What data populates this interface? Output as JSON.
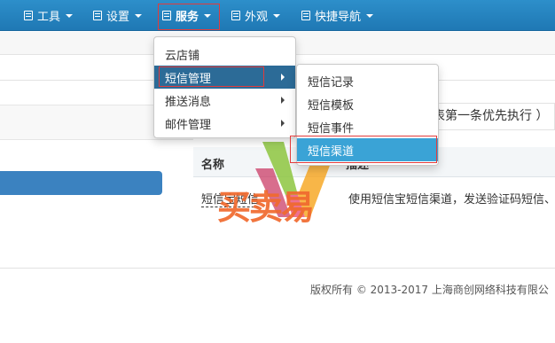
{
  "colors": {
    "navbar": "#2583c0",
    "highlight": "#2c6b97",
    "highlight_active": "#3aa3d6",
    "annotation": "#e23b3b",
    "logo": "#f06a2e"
  },
  "navbar": {
    "items": [
      {
        "label": "工具",
        "icon": "list-icon"
      },
      {
        "label": "设置",
        "icon": "list-icon"
      },
      {
        "label": "服务",
        "icon": "list-icon"
      },
      {
        "label": "外观",
        "icon": "list-icon"
      },
      {
        "label": "快捷导航",
        "icon": "list-icon"
      }
    ]
  },
  "service_menu": {
    "items": [
      {
        "label": "云店铺"
      },
      {
        "label": "短信管理"
      },
      {
        "label": "推送消息"
      },
      {
        "label": "邮件管理"
      }
    ]
  },
  "sms_menu": {
    "items": [
      {
        "label": "短信记录"
      },
      {
        "label": "短信模板"
      },
      {
        "label": "短信事件"
      },
      {
        "label": "短信渠道"
      }
    ]
  },
  "notice": "表第一条优先执行 ）",
  "table": {
    "headers": [
      "名称",
      "描述"
    ],
    "rows": [
      {
        "name": "短信宝短信",
        "description": "使用短信宝短信渠道，发送验证码短信、"
      }
    ]
  },
  "watermark": "买卖易",
  "footer": "版权所有 © 2013-2017 上海商创网络科技有限公"
}
